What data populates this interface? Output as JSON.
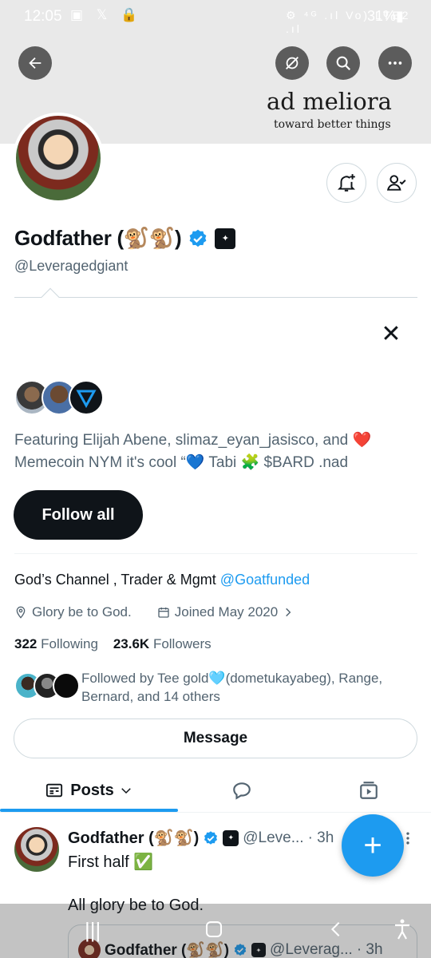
{
  "status_bar": {
    "time": "12:05",
    "left_icons": "▣ 𝕏 🔒",
    "right_icons": "⚙ ⁴ᴳ .ıl Vo) LTE2 .ıl",
    "battery": "31%▮"
  },
  "banner": {
    "title": "ad meliora",
    "subtitle": "toward better things"
  },
  "profile": {
    "name": "Godfather (🐒🐒)",
    "handle": "@Leveragedgiant",
    "affiliate_badge": "✦",
    "bio_text": "God’s Channel , Trader & Mgmt ",
    "bio_link": "@Goatfunded",
    "location": "Glory be to God.",
    "joined": "Joined May 2020",
    "following_count": "322",
    "following_label": "Following",
    "followers_count": "23.6K",
    "followers_label": "Followers",
    "followed_by": "Followed by Tee gold🩵(dometukayabeg), Range, Bernard, and 14 others"
  },
  "suggestions": {
    "text": "Featuring Elijah Abene, slimaz_eyan_jasisco, and ❤️ Memecoin NYM it's cool “💙 Tabi 🧩 $BARD .nad",
    "follow_all_label": "Follow all",
    "close_label": "✕"
  },
  "actions": {
    "message_label": "Message"
  },
  "tabs": {
    "posts_label": "Posts"
  },
  "post": {
    "name": "Godfather (🐒🐒)",
    "handle": "@Leve...",
    "time": "· 3h",
    "line1": "First half ✅",
    "line2": "All glory be to God."
  },
  "quote": {
    "name": "Godfather (🐒🐒)",
    "handle": "@Leverag...",
    "time": "· 3h"
  },
  "fab_label": "+",
  "colors": {
    "accent": "#1d9bf0",
    "text_primary": "#0f1419",
    "text_secondary": "#536471",
    "border": "#cfd9de"
  }
}
